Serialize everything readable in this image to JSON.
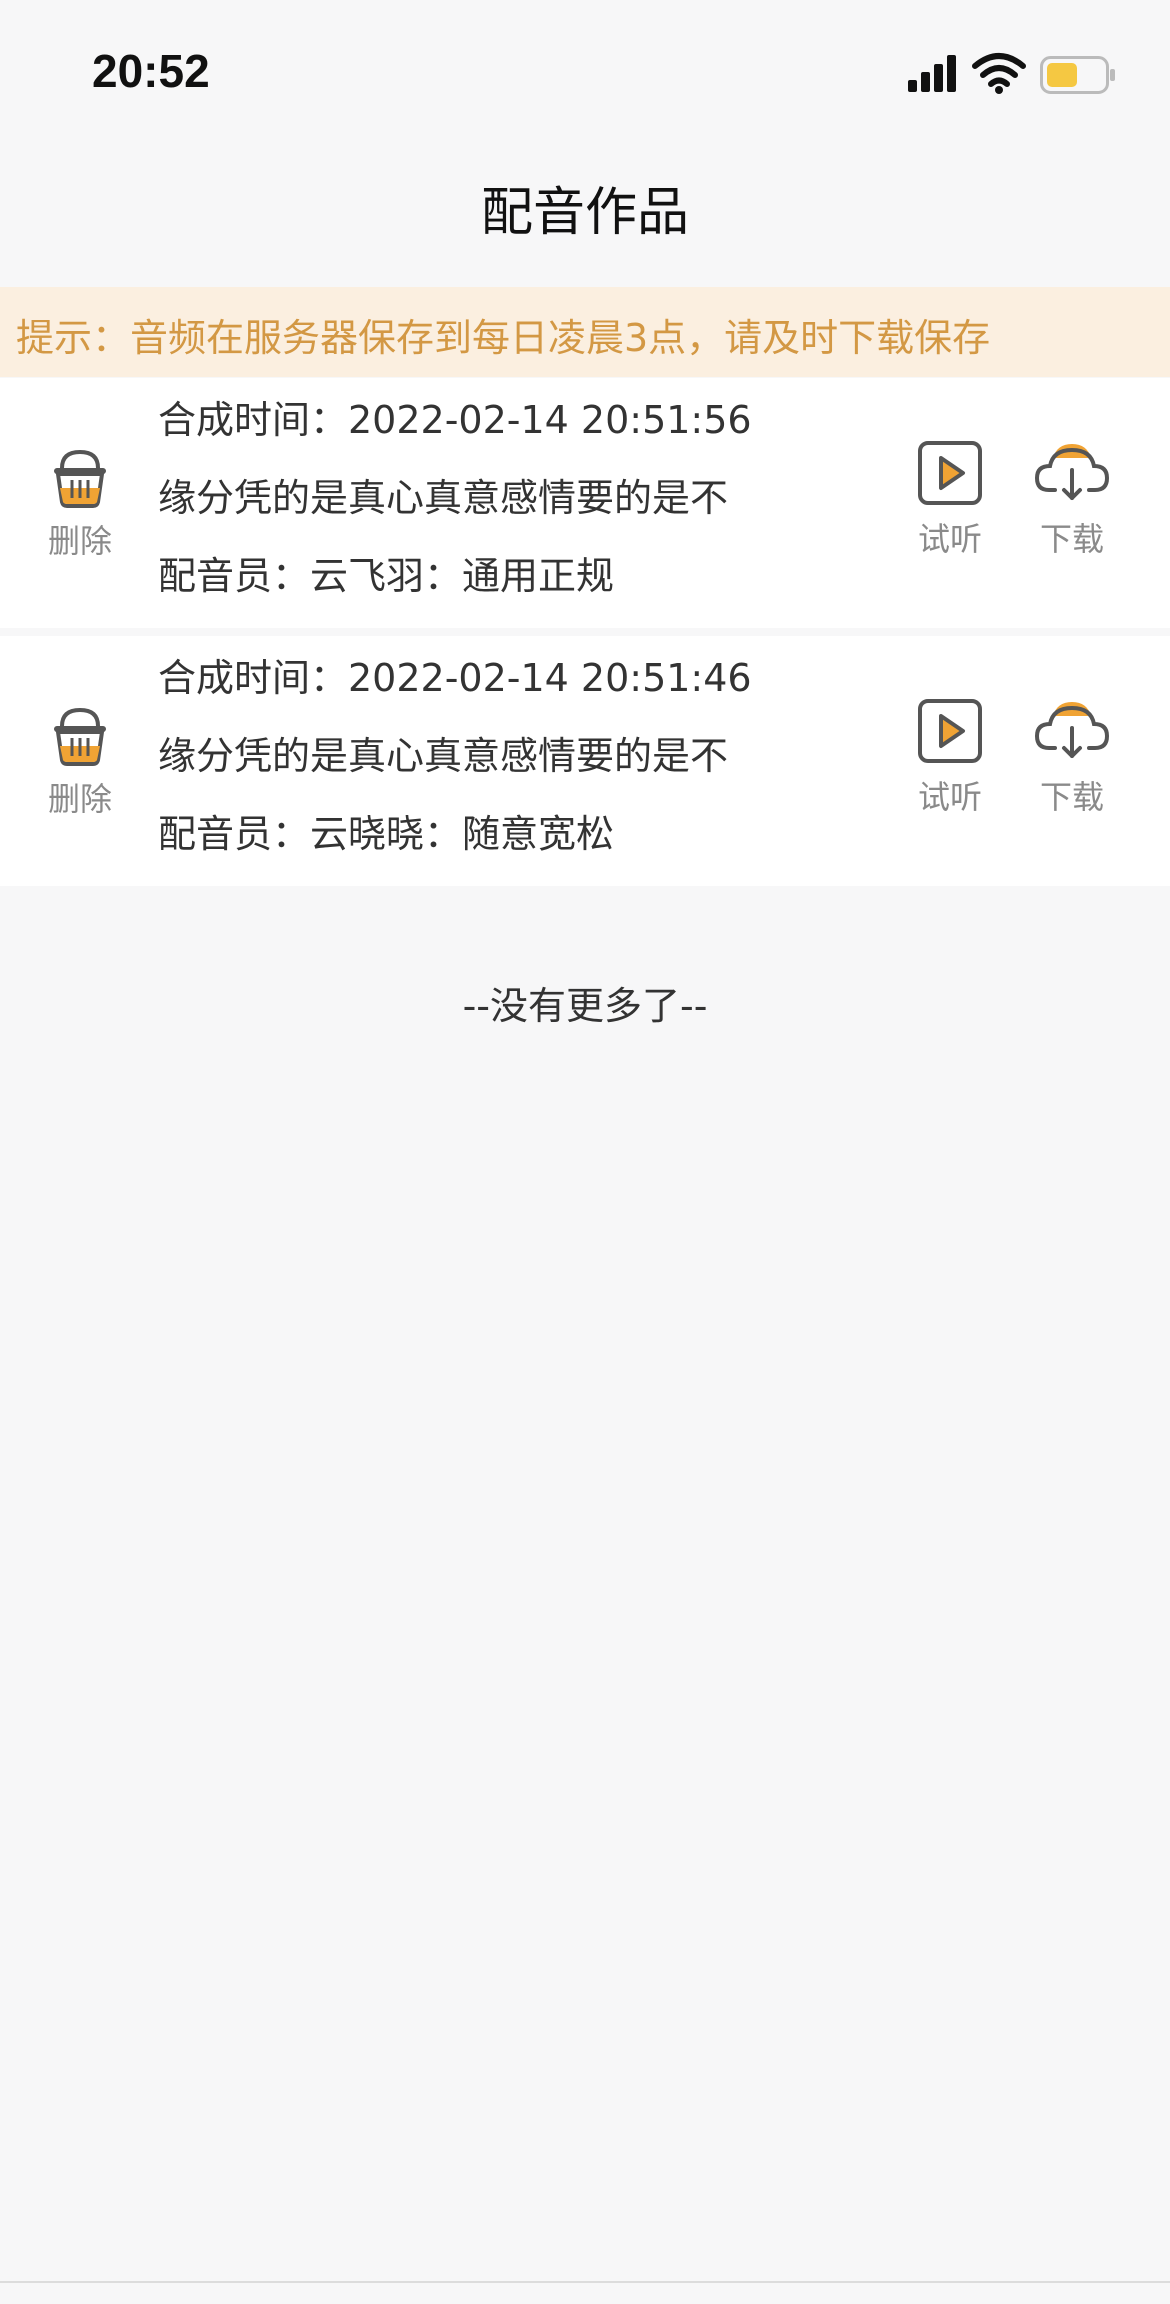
{
  "status_bar": {
    "time": "20:52",
    "icons": [
      "signal-icon",
      "wifi-icon",
      "battery-icon"
    ],
    "battery_color": "#f5c842"
  },
  "header": {
    "title": "配音作品"
  },
  "notice": {
    "text": "提示：音频在服务器保存到每日凌晨3点，请及时下载保存",
    "color": "#d39844",
    "background": "#fbefe0"
  },
  "items": [
    {
      "time_label": "合成时间：2022-02-14 20:51:56",
      "text_preview": "缘分凭的是真心真意感情要的是不",
      "voice": "配音员：云飞羽：通用正规",
      "delete_label": "删除",
      "listen_label": "试听",
      "download_label": "下载"
    },
    {
      "time_label": "合成时间：2022-02-14 20:51:46",
      "text_preview": "缘分凭的是真心真意感情要的是不",
      "voice": "配音员：云晓晓：随意宽松",
      "delete_label": "删除",
      "listen_label": "试听",
      "download_label": "下载"
    }
  ],
  "footer": {
    "no_more": "--没有更多了--"
  },
  "colors": {
    "accent": "#f0a334",
    "icon_stroke": "#555555",
    "background": "#f7f7f8"
  }
}
